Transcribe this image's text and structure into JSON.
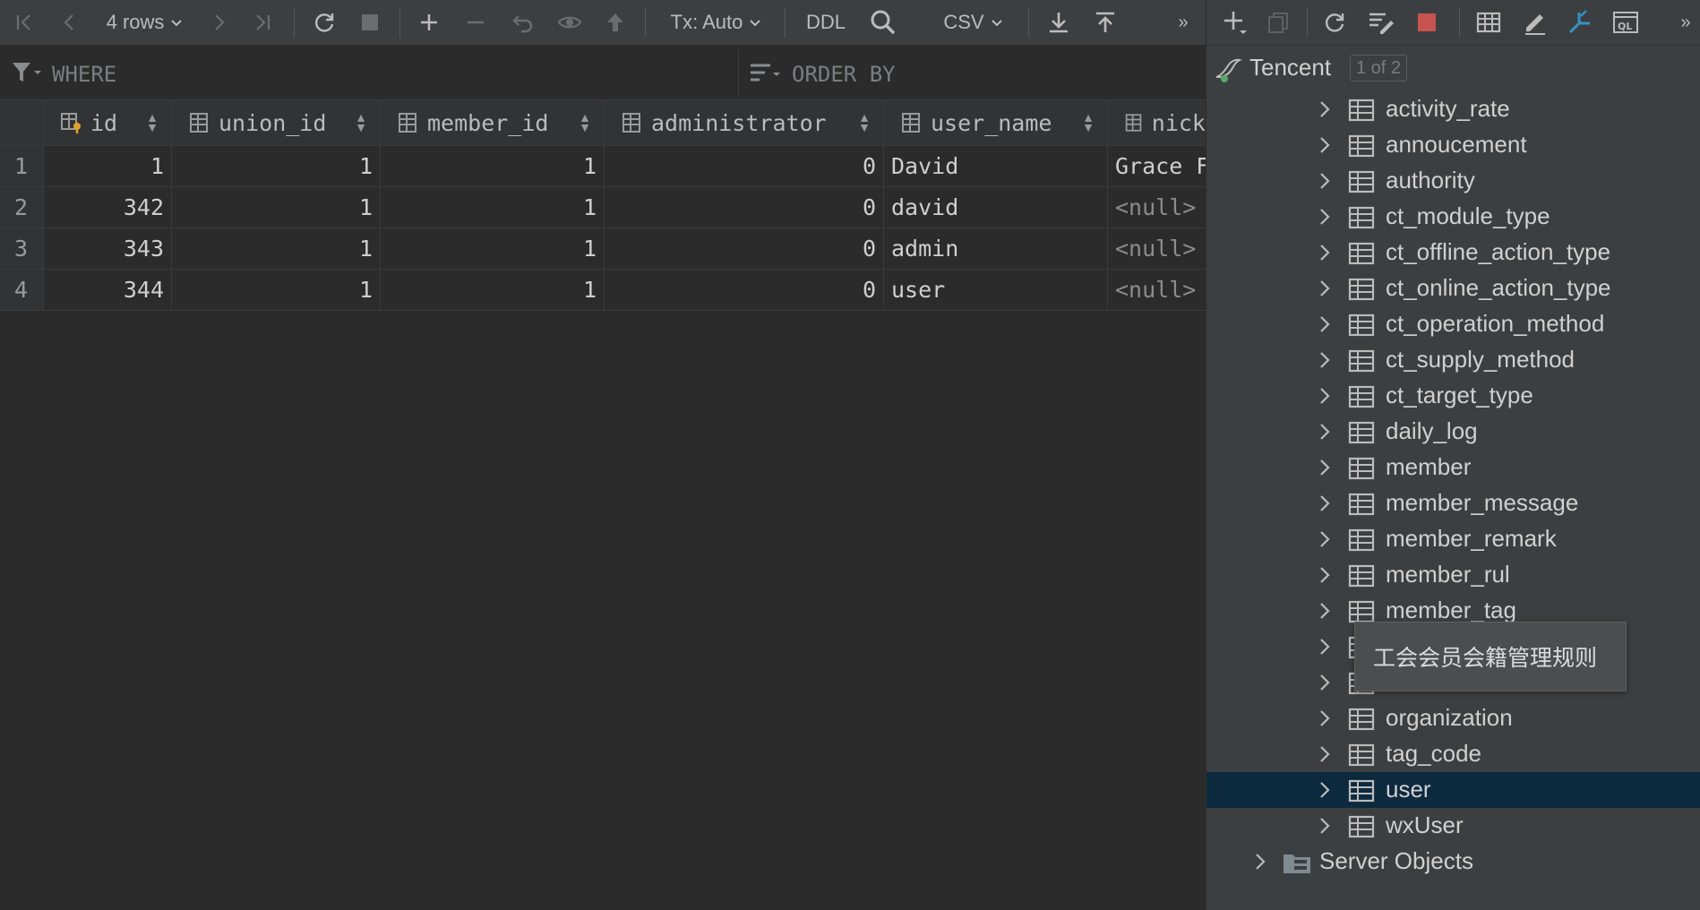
{
  "toolbar": {
    "rows_label": "4 rows",
    "tx_label": "Tx: Auto",
    "ddl_label": "DDL",
    "format_label": "CSV",
    "more_label": "»"
  },
  "filter": {
    "where_placeholder": "WHERE",
    "orderby_placeholder": "ORDER BY"
  },
  "grid": {
    "columns": [
      "id",
      "union_id",
      "member_id",
      "administrator",
      "user_name",
      "nick"
    ],
    "rows": [
      {
        "num": "1",
        "id": "1",
        "union_id": "1",
        "member_id": "1",
        "administrator": "0",
        "user_name": "David",
        "nick": "Grace F"
      },
      {
        "num": "2",
        "id": "342",
        "union_id": "1",
        "member_id": "1",
        "administrator": "0",
        "user_name": "david",
        "nick": "<null>"
      },
      {
        "num": "3",
        "id": "343",
        "union_id": "1",
        "member_id": "1",
        "administrator": "0",
        "user_name": "admin",
        "nick": "<null>"
      },
      {
        "num": "4",
        "id": "344",
        "union_id": "1",
        "member_id": "1",
        "administrator": "0",
        "user_name": "user",
        "nick": "<null>"
      }
    ]
  },
  "db_tree": {
    "root_label": "Tencent",
    "root_badge": "1 of 2",
    "tables": [
      "activity_rate",
      "annoucement",
      "authority",
      "ct_module_type",
      "ct_offline_action_type",
      "ct_online_action_type",
      "ct_operation_method",
      "ct_supply_method",
      "ct_target_type",
      "daily_log",
      "member",
      "member_message",
      "member_remark",
      "member_rul",
      "member_tag",
      "",
      "",
      "organization",
      "tag_code",
      "user",
      "wxUser"
    ],
    "selected_table": "user",
    "server_objects_label": "Server Objects",
    "tooltip": "工会会员会籍管理规则"
  },
  "colors": {
    "background": "#2b2b2b",
    "panel": "#3c3f41",
    "selection": "#0d293e",
    "accent_blue": "#3592c4",
    "stop_red": "#c75450"
  }
}
